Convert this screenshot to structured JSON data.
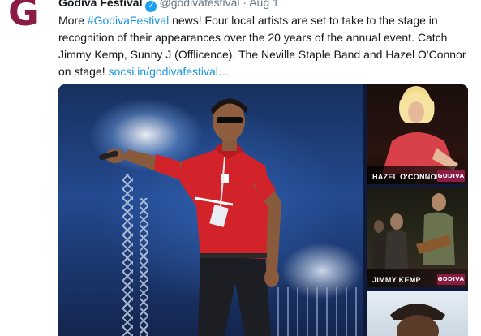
{
  "account": {
    "name": "Godiva Festival",
    "handle": "@godivafestival",
    "separator": "·",
    "date": "Aug 1",
    "avatar_letter": "G",
    "verified_icon": "verified-badge-icon",
    "brand_color": "#8c1c44"
  },
  "tweet": {
    "text_before": "More ",
    "hashtag": "#GodivaFestival",
    "text_after": " news!  Four local artists are set to take to the stage in recognition of their appearances over the 20 years of the annual event. Catch Jimmy Kemp, Sunny J (Offlicence), The Neville Staple Band and Hazel O'Connor on stage!  ",
    "link": "socsi.in/godivafestival…"
  },
  "media": {
    "main_alt": "Performer on stage at Godiva Festival",
    "thumbs": [
      {
        "caption": "HAZEL O'CONNOR",
        "logo": "GODIVA"
      },
      {
        "caption": "JIMMY KEMP",
        "logo": "GODIVA"
      },
      {
        "caption": "",
        "logo": ""
      }
    ]
  }
}
